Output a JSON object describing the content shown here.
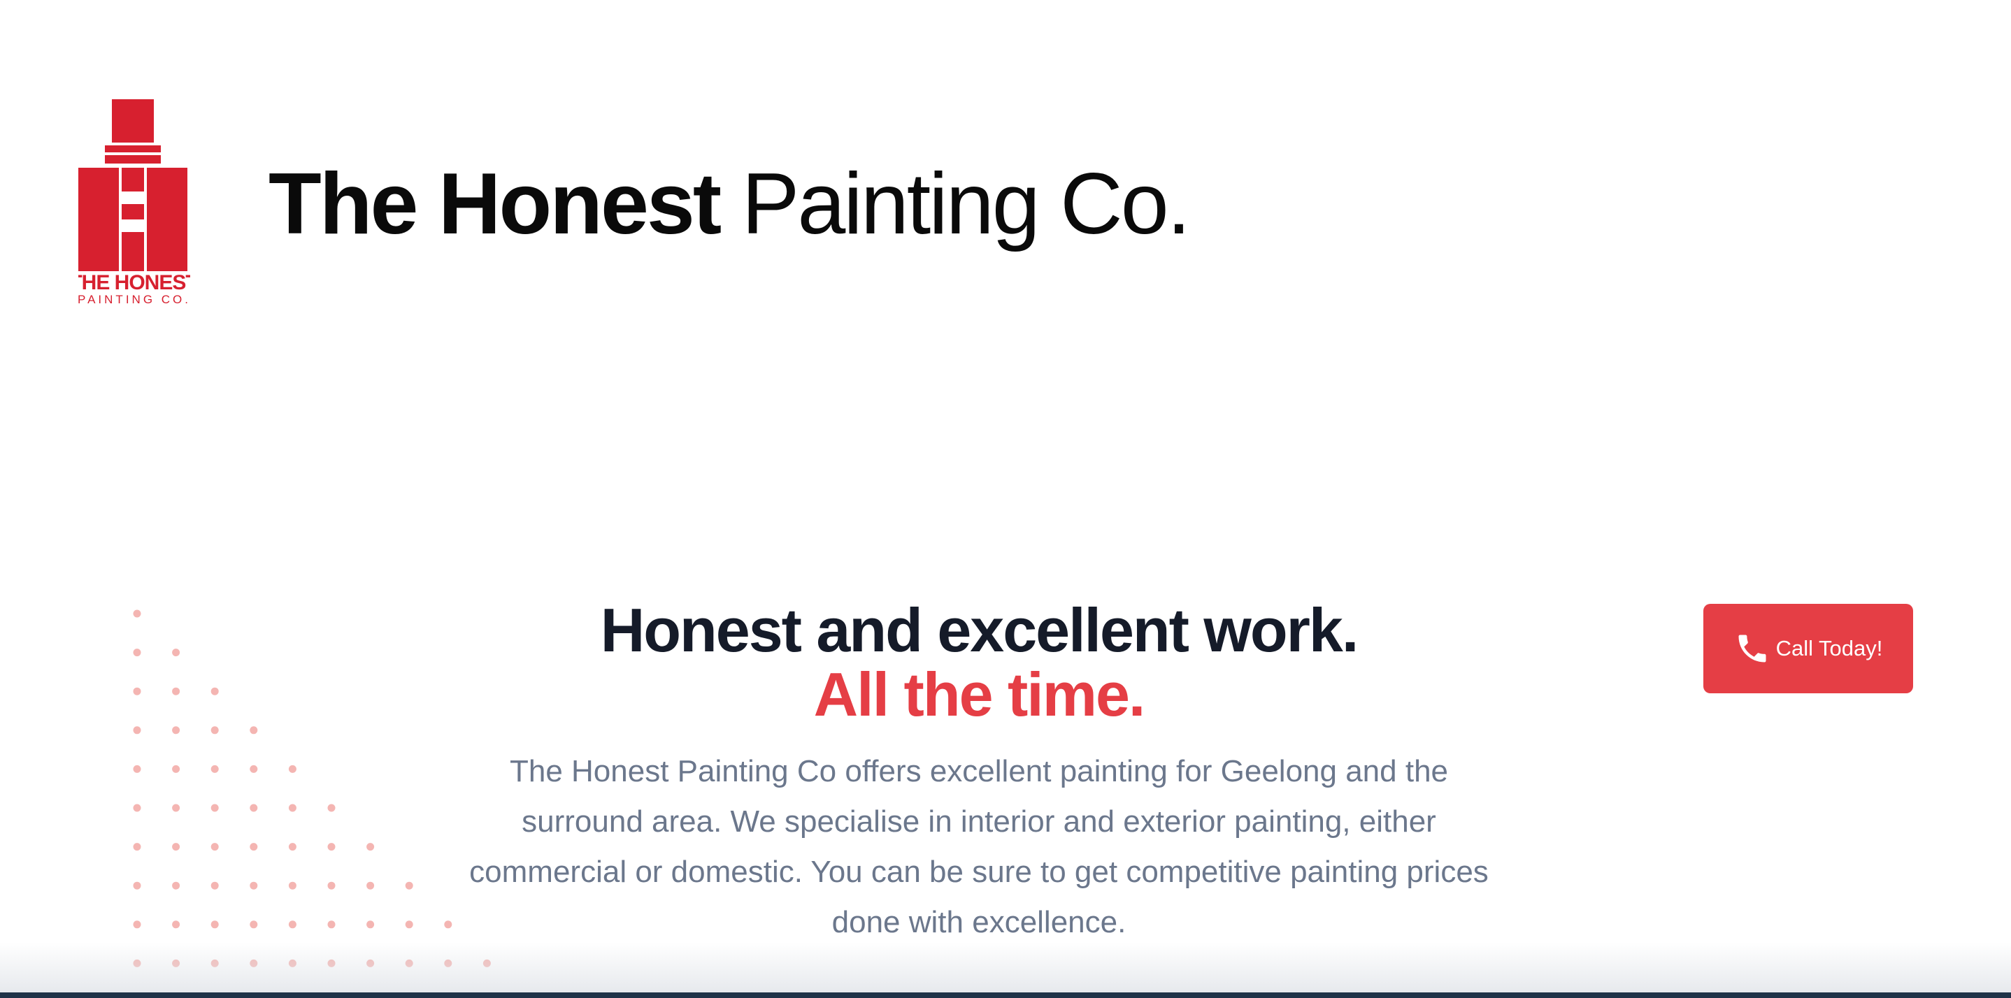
{
  "header": {
    "logo": {
      "text_line1": "THE HONEST",
      "text_line2": "PAINTING CO.",
      "color": "#d7202f"
    },
    "title_bold": "The Honest",
    "title_light": "Painting Co."
  },
  "hero": {
    "headline": "Honest and excellent work.",
    "headline_accent": "All the time.",
    "description": "The Honest Painting Co offers excellent painting for Geelong and the surround area. We specialise in interior and exterior painting, either commercial or domestic. You can be sure to get competitive painting prices done with excellence.",
    "headline_color": "#151b29",
    "accent_color": "#e53e45",
    "description_color": "#6b778c"
  },
  "cta": {
    "label": "Call Today!",
    "icon": "phone-icon",
    "background_color": "#e53e45"
  },
  "decoration": {
    "dots_color": "#f4b5b2"
  }
}
